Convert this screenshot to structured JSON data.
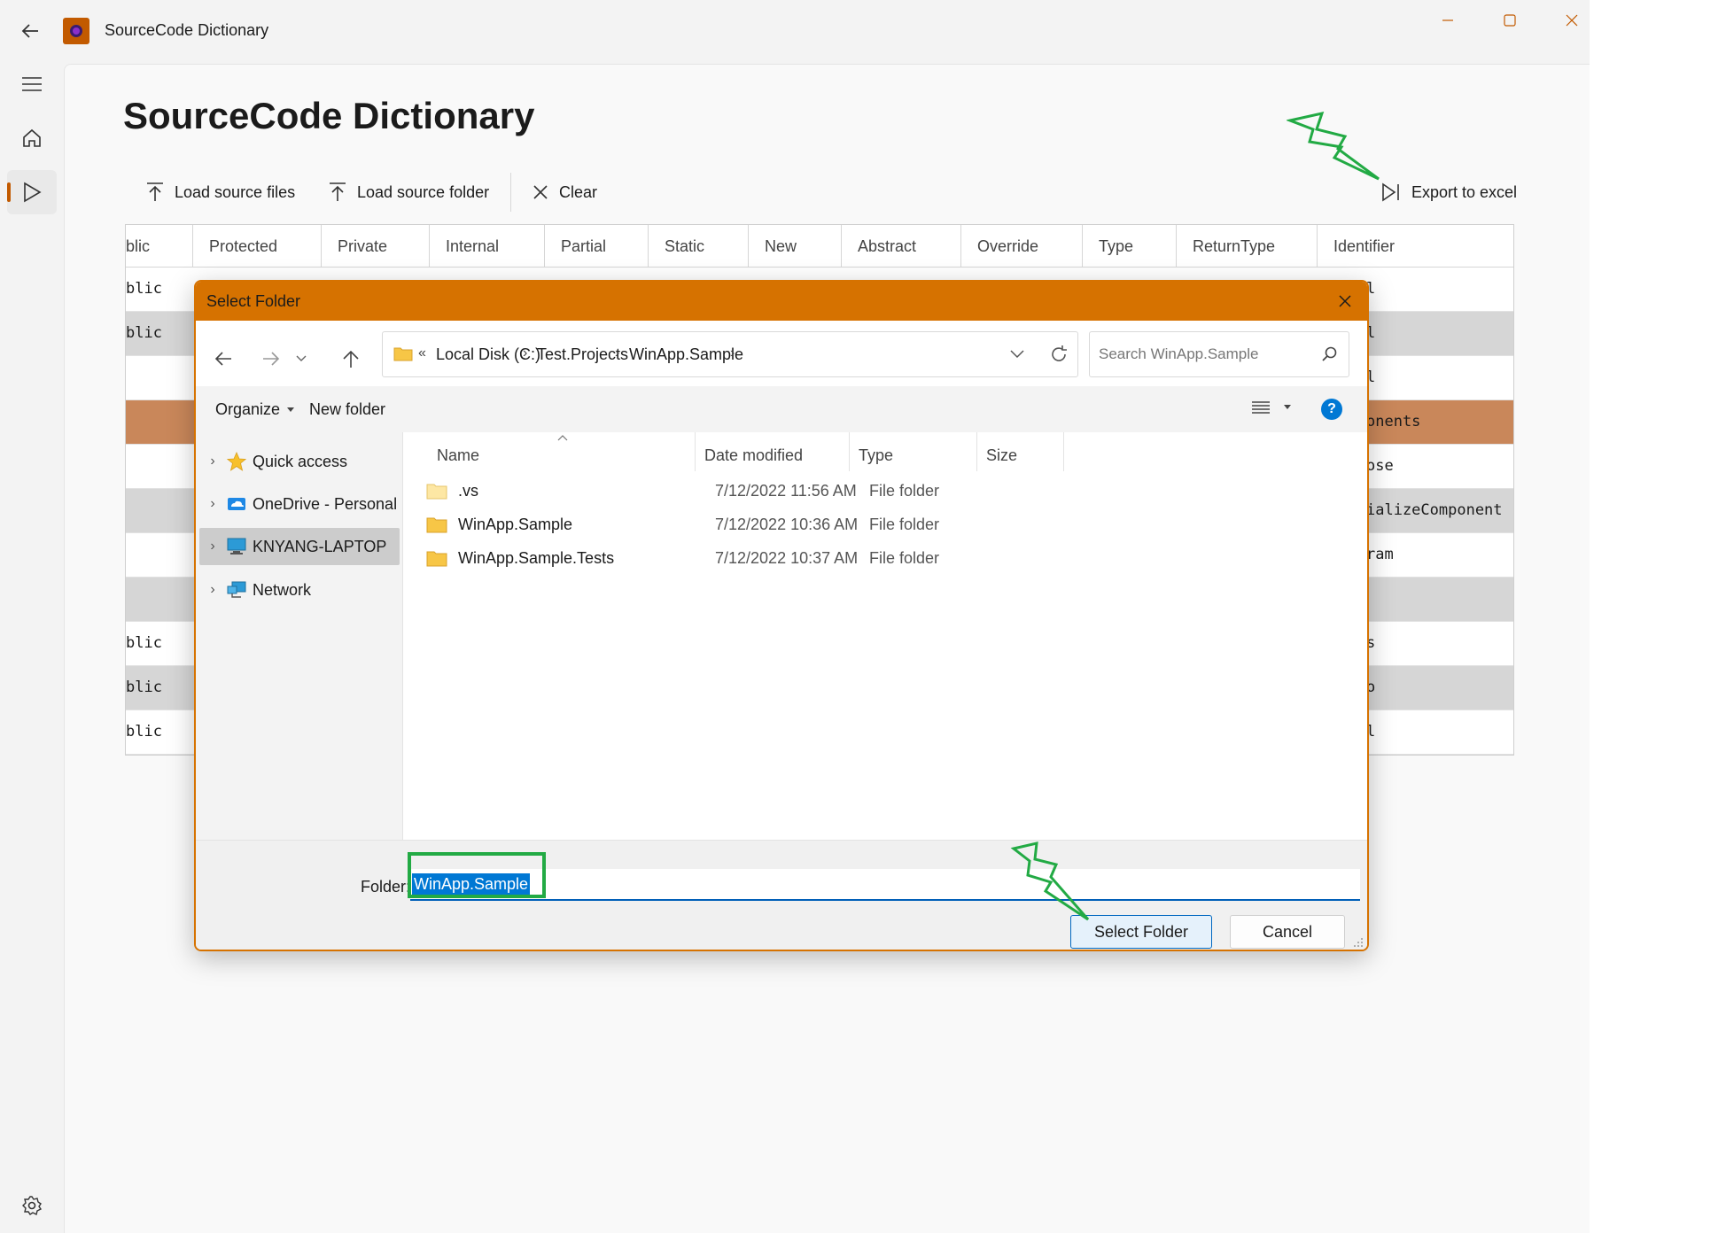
{
  "app": {
    "title": "SourceCode Dictionary",
    "page_title": "SourceCode Dictionary",
    "accent": "#c25a00",
    "commands": {
      "load_files": "Load source files",
      "load_folder": "Load source folder",
      "clear": "Clear",
      "export": "Export to excel"
    },
    "grid": {
      "columns": [
        "blic",
        "Protected",
        "Private",
        "Internal",
        "Partial",
        "Static",
        "New",
        "Abstract",
        "Override",
        "Type",
        "ReturnType",
        "Identifier"
      ],
      "rows": [
        {
          "first": "blic",
          "last": "l"
        },
        {
          "first": "blic",
          "last": "l"
        },
        {
          "first": "",
          "last": "l"
        },
        {
          "first": "",
          "last": "onents"
        },
        {
          "first": "",
          "last": "ose"
        },
        {
          "first": "",
          "last": "ializeComponent"
        },
        {
          "first": "",
          "last": "ram"
        },
        {
          "first": "",
          "last": ""
        },
        {
          "first": "blic",
          "last": "s"
        },
        {
          "first": "blic",
          "last": "o"
        },
        {
          "first": "blic",
          "last": "l"
        }
      ]
    }
  },
  "dialog": {
    "title": "Select Folder",
    "accent": "#d67200",
    "breadcrumb": {
      "overflow": "«",
      "items": [
        "Local Disk (C:)",
        "Test.Projects",
        "WinApp.Sample"
      ]
    },
    "search_placeholder": "Search WinApp.Sample",
    "toolbar": {
      "organize": "Organize",
      "new_folder": "New folder"
    },
    "tree": [
      {
        "label": "Quick access"
      },
      {
        "label": "OneDrive - Personal"
      },
      {
        "label": "KNYANG-LAPTOP"
      },
      {
        "label": "Network"
      }
    ],
    "columns": [
      "Name",
      "Date modified",
      "Type",
      "Size"
    ],
    "files": [
      {
        "name": ".vs",
        "date": "7/12/2022 11:56 AM",
        "type": "File folder"
      },
      {
        "name": "WinApp.Sample",
        "date": "7/12/2022 10:36 AM",
        "type": "File folder"
      },
      {
        "name": "WinApp.Sample.Tests",
        "date": "7/12/2022 10:37 AM",
        "type": "File folder"
      }
    ],
    "folder_label": "Folder:",
    "folder_value": "WinApp.Sample",
    "select_button": "Select Folder",
    "cancel_button": "Cancel"
  },
  "annotation_color": "#22aa44"
}
